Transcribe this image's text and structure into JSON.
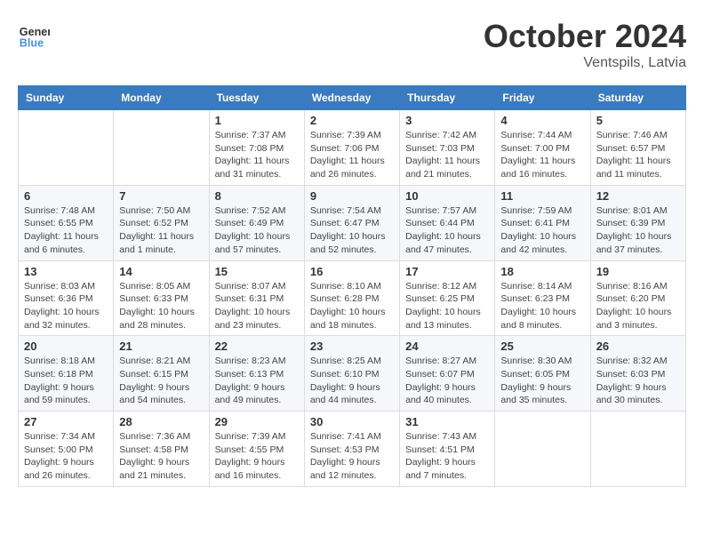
{
  "header": {
    "logo_line1": "General",
    "logo_line2": "Blue",
    "month": "October 2024",
    "location": "Ventspils, Latvia"
  },
  "weekdays": [
    "Sunday",
    "Monday",
    "Tuesday",
    "Wednesday",
    "Thursday",
    "Friday",
    "Saturday"
  ],
  "weeks": [
    [
      {
        "day": "",
        "info": ""
      },
      {
        "day": "",
        "info": ""
      },
      {
        "day": "1",
        "info": "Sunrise: 7:37 AM\nSunset: 7:08 PM\nDaylight: 11 hours and 31 minutes."
      },
      {
        "day": "2",
        "info": "Sunrise: 7:39 AM\nSunset: 7:06 PM\nDaylight: 11 hours and 26 minutes."
      },
      {
        "day": "3",
        "info": "Sunrise: 7:42 AM\nSunset: 7:03 PM\nDaylight: 11 hours and 21 minutes."
      },
      {
        "day": "4",
        "info": "Sunrise: 7:44 AM\nSunset: 7:00 PM\nDaylight: 11 hours and 16 minutes."
      },
      {
        "day": "5",
        "info": "Sunrise: 7:46 AM\nSunset: 6:57 PM\nDaylight: 11 hours and 11 minutes."
      }
    ],
    [
      {
        "day": "6",
        "info": "Sunrise: 7:48 AM\nSunset: 6:55 PM\nDaylight: 11 hours and 6 minutes."
      },
      {
        "day": "7",
        "info": "Sunrise: 7:50 AM\nSunset: 6:52 PM\nDaylight: 11 hours and 1 minute."
      },
      {
        "day": "8",
        "info": "Sunrise: 7:52 AM\nSunset: 6:49 PM\nDaylight: 10 hours and 57 minutes."
      },
      {
        "day": "9",
        "info": "Sunrise: 7:54 AM\nSunset: 6:47 PM\nDaylight: 10 hours and 52 minutes."
      },
      {
        "day": "10",
        "info": "Sunrise: 7:57 AM\nSunset: 6:44 PM\nDaylight: 10 hours and 47 minutes."
      },
      {
        "day": "11",
        "info": "Sunrise: 7:59 AM\nSunset: 6:41 PM\nDaylight: 10 hours and 42 minutes."
      },
      {
        "day": "12",
        "info": "Sunrise: 8:01 AM\nSunset: 6:39 PM\nDaylight: 10 hours and 37 minutes."
      }
    ],
    [
      {
        "day": "13",
        "info": "Sunrise: 8:03 AM\nSunset: 6:36 PM\nDaylight: 10 hours and 32 minutes."
      },
      {
        "day": "14",
        "info": "Sunrise: 8:05 AM\nSunset: 6:33 PM\nDaylight: 10 hours and 28 minutes."
      },
      {
        "day": "15",
        "info": "Sunrise: 8:07 AM\nSunset: 6:31 PM\nDaylight: 10 hours and 23 minutes."
      },
      {
        "day": "16",
        "info": "Sunrise: 8:10 AM\nSunset: 6:28 PM\nDaylight: 10 hours and 18 minutes."
      },
      {
        "day": "17",
        "info": "Sunrise: 8:12 AM\nSunset: 6:25 PM\nDaylight: 10 hours and 13 minutes."
      },
      {
        "day": "18",
        "info": "Sunrise: 8:14 AM\nSunset: 6:23 PM\nDaylight: 10 hours and 8 minutes."
      },
      {
        "day": "19",
        "info": "Sunrise: 8:16 AM\nSunset: 6:20 PM\nDaylight: 10 hours and 3 minutes."
      }
    ],
    [
      {
        "day": "20",
        "info": "Sunrise: 8:18 AM\nSunset: 6:18 PM\nDaylight: 9 hours and 59 minutes."
      },
      {
        "day": "21",
        "info": "Sunrise: 8:21 AM\nSunset: 6:15 PM\nDaylight: 9 hours and 54 minutes."
      },
      {
        "day": "22",
        "info": "Sunrise: 8:23 AM\nSunset: 6:13 PM\nDaylight: 9 hours and 49 minutes."
      },
      {
        "day": "23",
        "info": "Sunrise: 8:25 AM\nSunset: 6:10 PM\nDaylight: 9 hours and 44 minutes."
      },
      {
        "day": "24",
        "info": "Sunrise: 8:27 AM\nSunset: 6:07 PM\nDaylight: 9 hours and 40 minutes."
      },
      {
        "day": "25",
        "info": "Sunrise: 8:30 AM\nSunset: 6:05 PM\nDaylight: 9 hours and 35 minutes."
      },
      {
        "day": "26",
        "info": "Sunrise: 8:32 AM\nSunset: 6:03 PM\nDaylight: 9 hours and 30 minutes."
      }
    ],
    [
      {
        "day": "27",
        "info": "Sunrise: 7:34 AM\nSunset: 5:00 PM\nDaylight: 9 hours and 26 minutes."
      },
      {
        "day": "28",
        "info": "Sunrise: 7:36 AM\nSunset: 4:58 PM\nDaylight: 9 hours and 21 minutes."
      },
      {
        "day": "29",
        "info": "Sunrise: 7:39 AM\nSunset: 4:55 PM\nDaylight: 9 hours and 16 minutes."
      },
      {
        "day": "30",
        "info": "Sunrise: 7:41 AM\nSunset: 4:53 PM\nDaylight: 9 hours and 12 minutes."
      },
      {
        "day": "31",
        "info": "Sunrise: 7:43 AM\nSunset: 4:51 PM\nDaylight: 9 hours and 7 minutes."
      },
      {
        "day": "",
        "info": ""
      },
      {
        "day": "",
        "info": ""
      }
    ]
  ]
}
